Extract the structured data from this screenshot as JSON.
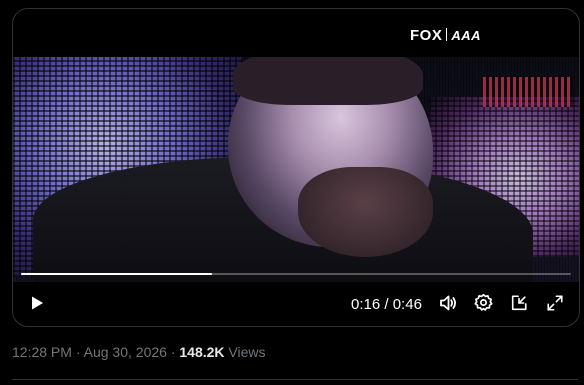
{
  "video": {
    "brand_logo": "FOX",
    "brand_logo_secondary": "AAA",
    "current_time": "0:16",
    "duration": "0:46",
    "time_separator": " / ",
    "progress_fraction": 0.348
  },
  "controls": {
    "play_icon": "play-icon",
    "volume_icon": "volume-icon",
    "settings_icon": "gear-icon",
    "pop_out_icon": "pop-out-icon",
    "fullscreen_icon": "fullscreen-icon"
  },
  "post_meta": {
    "time": "12:28 PM",
    "date": "Aug 30, 2026",
    "dot": "·",
    "views_count": "148.2K",
    "views_label": "Views"
  },
  "colors": {
    "background": "#000000",
    "muted_text": "#71767b",
    "border": "#2f3336"
  }
}
